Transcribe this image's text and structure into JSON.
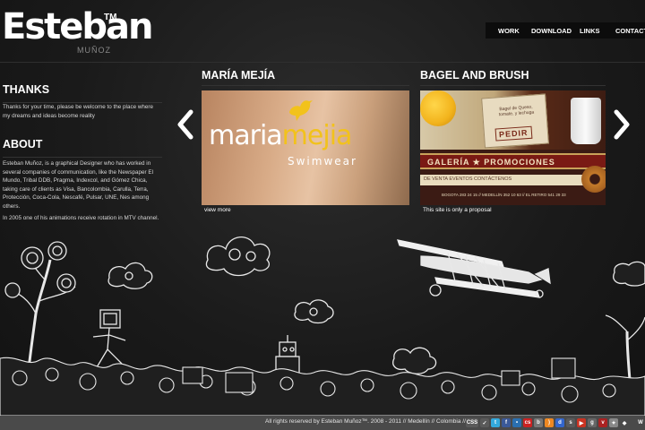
{
  "logo": {
    "main": "Esteban",
    "tm": "TM",
    "sub": "MUÑOZ"
  },
  "nav": {
    "work": "WORK",
    "download": "DOWNLOAD",
    "links": "LINKS",
    "contact": "CONTACT"
  },
  "thanks": {
    "title": "THANKS",
    "text": "Thanks for your time, please be welcome to the place where my dreams and ideas become reality"
  },
  "about": {
    "title": "ABOUT",
    "text": "Esteban Muñoz, is a graphical Designer who has worked in several companies of communication, like the Newspaper El Mundo, Tribal DDB, Pragma, Indexcol, and Gómez Chica, taking care of clients as Visa, Bancolombia, Carulla, Terra, Protección, Coca-Cola, Nescafé, Pulsar, UNE, Nes among others.",
    "text2": "In 2005 one of his animations receive rotation in MTV channel."
  },
  "projects": [
    {
      "title": "MARÍA MEJÍA",
      "brand_a": "maria",
      "brand_b": "mejia",
      "brand_sub": "Swimwear",
      "caption": "view more"
    },
    {
      "title": "BAGEL AND BRUSH",
      "note": "Bagel de Queso, tomate, y lechuga",
      "pedir": "PEDIR",
      "band": "GALERÍA ★ PROMOCIONES",
      "sub": "DE VENTA    EVENTOS    CONTÁCTENOS",
      "addr": "BOGOTA 283 24 15 // MEDELLÍN 352 10 63 // EL RETIRO 541 29 33",
      "caption": "This site is only a proposal"
    }
  ],
  "footer": {
    "text": "All rights reserved by Esteban Muñoz™. 2008 - 2011 // Medellín // Colombia //",
    "icons": [
      "css-icon",
      "check-icon",
      "twitter-icon",
      "facebook-icon",
      "flickr-icon",
      "lastfm-icon",
      "blogger-icon",
      "rss-icon",
      "delicious-icon",
      "stumble-icon",
      "youtube-icon",
      "digg-icon",
      "vimeo-icon",
      "deviant-icon",
      "tumblr-icon",
      "w-logo-icon"
    ],
    "css_label": "CSS"
  },
  "colors": {
    "accent_yellow": "#f2c21b",
    "footer_bg": "#4a4a4a",
    "bg_dark": "#1a1a1a"
  }
}
